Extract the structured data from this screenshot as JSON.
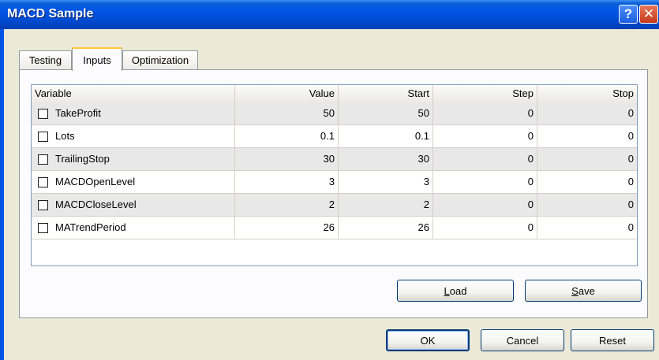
{
  "window": {
    "title": "MACD Sample"
  },
  "tabs": [
    {
      "label": "Testing"
    },
    {
      "label": "Inputs"
    },
    {
      "label": "Optimization"
    }
  ],
  "grid": {
    "columns": [
      "Variable",
      "Value",
      "Start",
      "Step",
      "Stop"
    ],
    "rows": [
      {
        "name": "TakeProfit",
        "value": "50",
        "start": "50",
        "step": "0",
        "stop": "0",
        "checked": false
      },
      {
        "name": "Lots",
        "value": "0.1",
        "start": "0.1",
        "step": "0",
        "stop": "0",
        "checked": false
      },
      {
        "name": "TrailingStop",
        "value": "30",
        "start": "30",
        "step": "0",
        "stop": "0",
        "checked": false
      },
      {
        "name": "MACDOpenLevel",
        "value": "3",
        "start": "3",
        "step": "0",
        "stop": "0",
        "checked": false
      },
      {
        "name": "MACDCloseLevel",
        "value": "2",
        "start": "2",
        "step": "0",
        "stop": "0",
        "checked": false
      },
      {
        "name": "MATrendPeriod",
        "value": "26",
        "start": "26",
        "step": "0",
        "stop": "0",
        "checked": false
      }
    ]
  },
  "panel_buttons": {
    "load_first": "L",
    "load_rest": "oad",
    "save_first": "S",
    "save_rest": "ave"
  },
  "dialog_buttons": {
    "ok": "OK",
    "cancel": "Cancel",
    "reset": "Reset"
  },
  "icons": {
    "help": "?",
    "close": "✕"
  }
}
